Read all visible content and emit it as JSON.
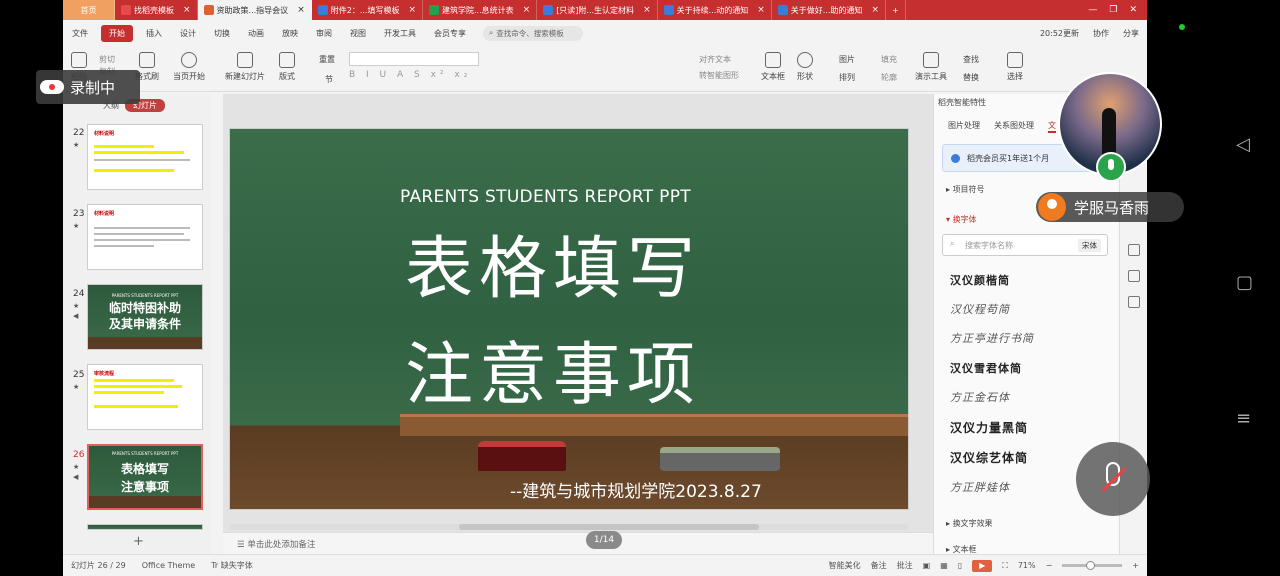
{
  "tabs": [
    {
      "label": "首页",
      "type": "home"
    },
    {
      "label": "找稻壳模板",
      "type": "normal",
      "color": "#e64a4a"
    },
    {
      "label": "资助政策...指导会议",
      "type": "active",
      "color": "#e06030"
    },
    {
      "label": "附件2：...填写模板",
      "type": "normal",
      "color": "#3a7cd8"
    },
    {
      "label": "建筑学院...息统计表",
      "type": "normal",
      "color": "#22a050"
    },
    {
      "label": "[只读]附...生认定材料",
      "type": "normal",
      "color": "#3a7cd8"
    },
    {
      "label": "关于持续...动的通知",
      "type": "normal",
      "color": "#3a7cd8"
    },
    {
      "label": "关于做好...助的通知",
      "type": "normal",
      "color": "#3a7cd8"
    }
  ],
  "menu": {
    "file": "文件",
    "items": [
      "开始",
      "插入",
      "设计",
      "切换",
      "动画",
      "放映",
      "审阅",
      "视图",
      "开发工具",
      "会员专享"
    ],
    "search_placeholder": "查找命令、搜索模板",
    "update": "20:52更新",
    "collab": "协作",
    "share": "分享"
  },
  "ribbon": {
    "paste": "粘贴",
    "cut": "剪切",
    "copy": "复制",
    "format_brush": "格式刷",
    "from_start": "当页开始",
    "new_slide": "新建幻灯片",
    "layout": "版式",
    "section": "节",
    "reset": "重置",
    "align_text": "对齐文本",
    "smartart": "转智能图形",
    "textbox": "文本框",
    "shape": "形状",
    "arrange": "排列",
    "picture": "图片",
    "fill": "填充",
    "outline": "轮廓",
    "presenter": "演示工具",
    "find": "查找",
    "replace": "替换",
    "select": "选择"
  },
  "outline": {
    "tab_outline": "大纲",
    "tab_slides": "幻灯片",
    "slides": [
      {
        "num": "22",
        "title": "材料说明",
        "kind": "doc"
      },
      {
        "num": "23",
        "title": "材料说明",
        "kind": "doc"
      },
      {
        "num": "24",
        "kind": "green",
        "sub": "PARENTS STUDENTS REPORT PPT",
        "line1": "临时特困补助",
        "line2": "及其申请条件"
      },
      {
        "num": "25",
        "title": "审核流程",
        "kind": "doc"
      },
      {
        "num": "26",
        "kind": "green",
        "sub": "PARENTS STUDENTS REPORT PPT",
        "line1": "表格填写",
        "line2": "注意事项",
        "selected": true
      }
    ],
    "add": "+"
  },
  "slide": {
    "subtitle": "PARENTS STUDENTS REPORT PPT",
    "title1": "表格填写",
    "title2": "注意事项",
    "signature": "--建筑与城市规划学院2023.8.27"
  },
  "notes_placeholder": "单击此处添加备注",
  "page_indicator": "1/14",
  "right_panel": {
    "title": "稻壳智能特性",
    "tabs": [
      "图片处理",
      "关系图处理",
      "文"
    ],
    "promo": "稻壳会员买1年送1个月",
    "bullet": "项目符号",
    "replace_font": "换字体",
    "font_search_placeholder": "搜索字体名称",
    "font_filter": "宋体",
    "fonts": [
      "汉仪颜楷简",
      "汉仪程苟简",
      "方正亭进行书简",
      "汉仪雪君体简",
      "方正金石体",
      "汉仪力量黑简",
      "汉仪综艺体简",
      "方正胖娃体"
    ],
    "text_effect": "换文字效果",
    "textbox_section": "文本框"
  },
  "status": {
    "slide_count": "幻灯片 26 / 29",
    "theme": "Office Theme",
    "missing_font": "缺失字体",
    "beautify": "智能美化",
    "notes": "备注",
    "comment": "批注",
    "zoom": "71%"
  },
  "overlay": {
    "recording": "录制中",
    "speaker_name": "学服马香雨"
  }
}
